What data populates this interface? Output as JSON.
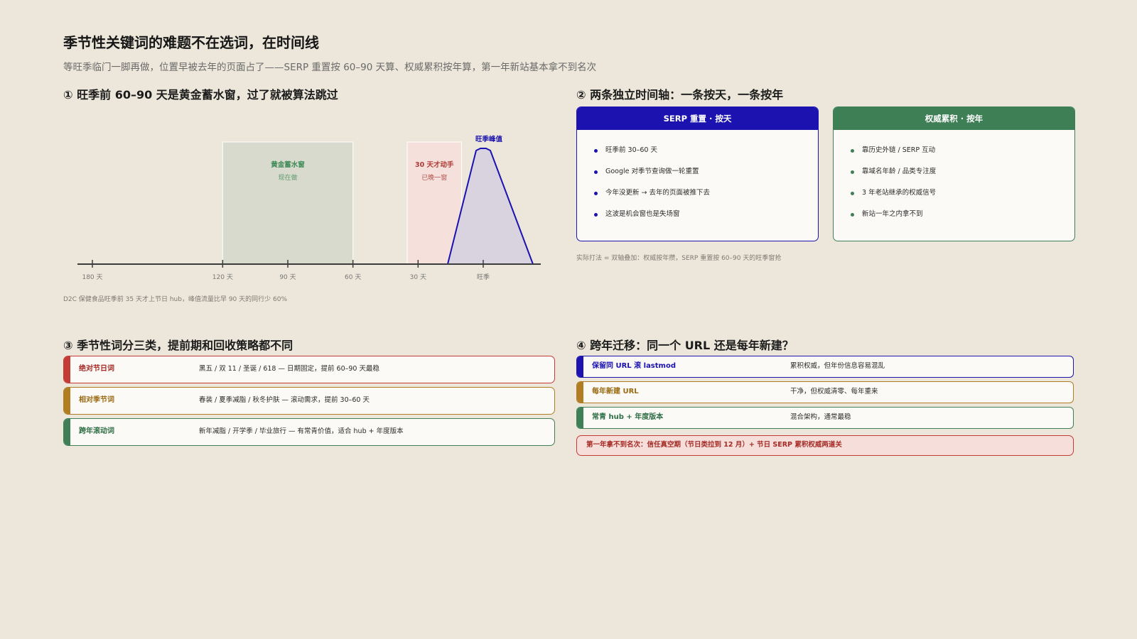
{
  "header": {
    "title": "季节性关键词的难题不在选词，在时间线",
    "subtitle": "等旺季临门一脚再做，位置早被去年的页面占了——SERP 重置按 60–90 天算、权威累积按年算，第一年新站基本拿不到名次"
  },
  "section1": {
    "title": "① 旺季前 60–90 天是黄金蓄水窗，过了就被算法跳过",
    "caption": "D2C 保健食品旺季前 35 天才上节日 hub，峰值流量比早 90 天的同行少 60%",
    "timeline": {
      "ticks": [
        {
          "label": "180 天",
          "days_before": 180
        },
        {
          "label": "120 天",
          "days_before": 120
        },
        {
          "label": "90 天",
          "days_before": 90
        },
        {
          "label": "60 天",
          "days_before": 60
        },
        {
          "label": "30 天",
          "days_before": 30
        },
        {
          "label": "旺季",
          "days_before": 0
        }
      ],
      "golden_window": {
        "title": "黄金蓄水窗",
        "sub": "现在做",
        "from_days": 120,
        "to_days": 60,
        "color": "#3e8a55"
      },
      "late_window": {
        "title": "30 天才动手",
        "sub": "已晚一窗",
        "from_days": 35,
        "to_days": 10,
        "color": "#b03a35"
      },
      "peak": {
        "label": "旺季峰值",
        "color": "#1b12b0"
      }
    }
  },
  "section2": {
    "title": "② 两条独立时间轴：一条按天，一条按年",
    "caption": "实际打法 = 双轴叠加：权威按年攒，SERP 重置按 60–90 天的旺季窗抢",
    "cards": [
      {
        "header": "SERP 重置 · 按天",
        "color": "#1b12b0",
        "items": [
          "旺季前 30–60 天",
          "Google 对季节查询做一轮重置",
          "今年没更新 → 去年的页面被推下去",
          "这波是机会窗也是失场窗"
        ]
      },
      {
        "header": "权威累积 · 按年",
        "color": "#3f7f56",
        "items": [
          "靠历史外链 / SERP 互动",
          "靠域名年龄 / 品类专注度",
          "3 年老站继承的权威信号",
          "新站一年之内拿不到"
        ]
      }
    ]
  },
  "section3": {
    "title": "③ 季节性词分三类，提前期和回收策略都不同",
    "rows": [
      {
        "name": "绝对节日词",
        "desc": "黑五 / 双 11 / 圣诞 / 618 — 日期固定，提前 60–90 天最稳",
        "color": "#c43b36",
        "text_color": "#a52a24"
      },
      {
        "name": "相对季节词",
        "desc": "春装 / 夏季减脂 / 秋冬护肤 — 滚动需求，提前 30–60 天",
        "color": "#b07d22",
        "text_color": "#9a6a12"
      },
      {
        "name": "跨年滚动词",
        "desc": "新年减脂 / 开学季 / 毕业旅行 — 有常青价值，适合 hub + 年度版本",
        "color": "#3f7f56",
        "text_color": "#2f6e44"
      }
    ]
  },
  "section4": {
    "title": "④ 跨年迁移：同一个 URL 还是每年新建？",
    "rows": [
      {
        "name": "保留同 URL 滚 lastmod",
        "desc": "累积权威，但年份信息容易混乱",
        "color": "#1b12b0",
        "text_color": "#1b12b0"
      },
      {
        "name": "每年新建 URL",
        "desc": "干净，但权威清零、每年重来",
        "color": "#b07d22",
        "text_color": "#9a6a12"
      },
      {
        "name": "常青 hub + 年度版本",
        "desc": "混合架构，通常最稳",
        "color": "#3f7f56",
        "text_color": "#2f6e44"
      }
    ],
    "warning": "第一年拿不到名次：信任真空期（节日类拉到 12 月）+ 节日 SERP 累积权威两道关"
  }
}
